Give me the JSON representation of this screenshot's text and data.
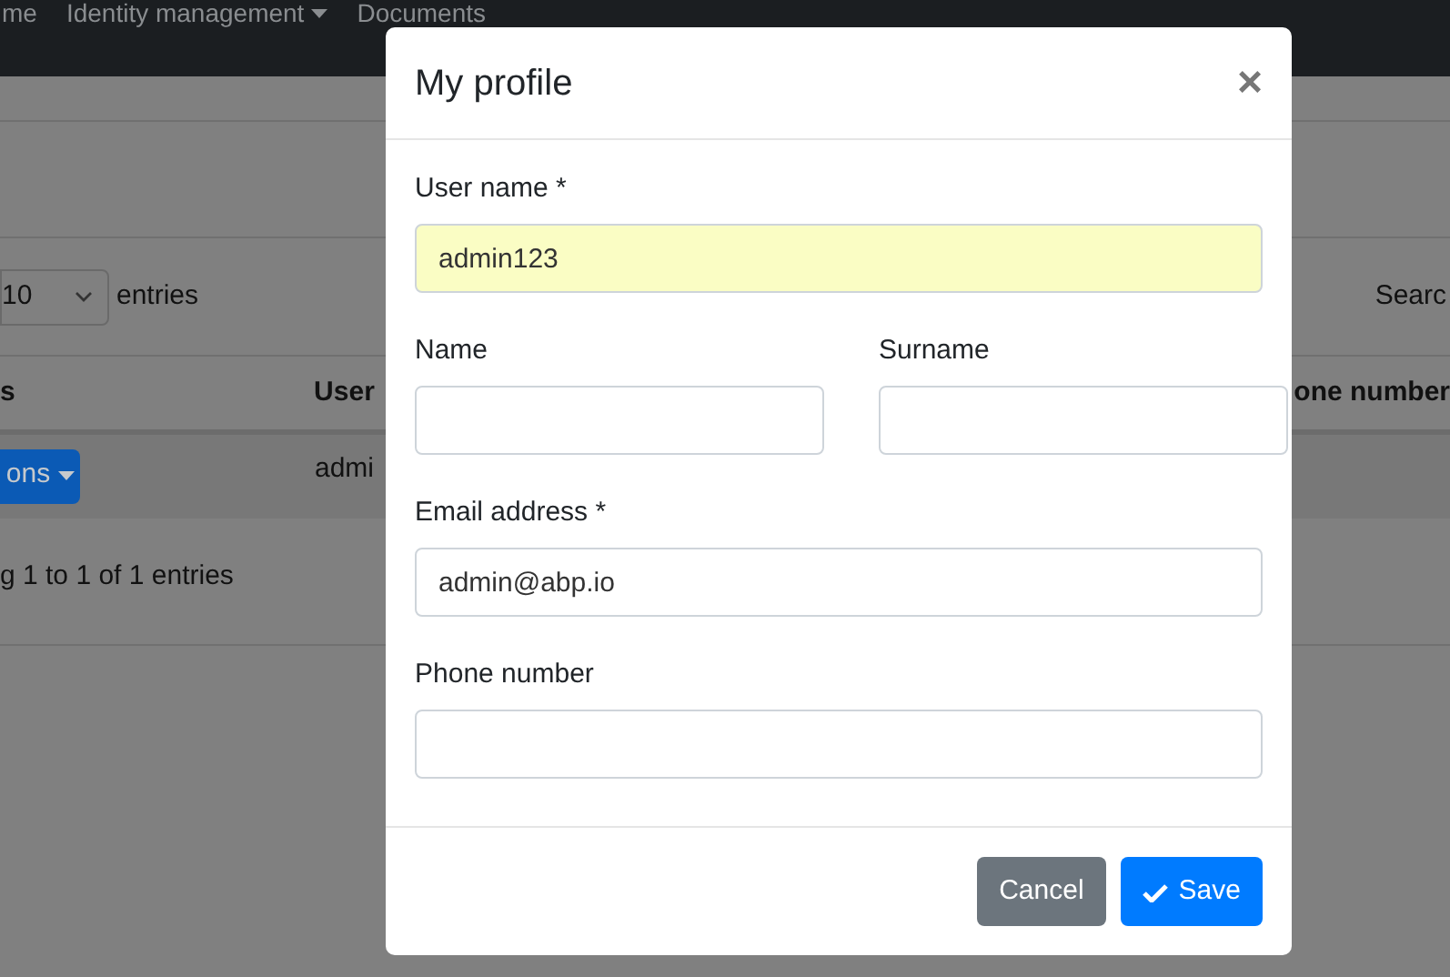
{
  "navbar": {
    "items": [
      {
        "label": "me",
        "dropdown": false
      },
      {
        "label": "Identity management",
        "dropdown": true
      },
      {
        "label": "Documents",
        "dropdown": false
      }
    ]
  },
  "background": {
    "page_size": "10",
    "entries_label": "entries",
    "search_label": "Searc",
    "columns": [
      "s",
      "User",
      "one number"
    ],
    "rows": [
      {
        "actions_button": "ons",
        "user_name": "admi"
      }
    ],
    "info": "g 1 to 1 of 1 entries"
  },
  "modal": {
    "title": "My profile",
    "close": "×",
    "field_rows": [
      [
        {
          "label": "User name *",
          "value": "admin123",
          "autofilled": true
        }
      ],
      [
        {
          "label": "Name",
          "autofilled": false
        },
        {
          "label": "Surname",
          "autofilled": false
        }
      ],
      [
        {
          "label": "Email address *",
          "value": "admin@abp.io",
          "autofilled": false
        }
      ],
      [
        {
          "label": "Phone number",
          "autofilled": false
        }
      ]
    ],
    "buttons": [
      {
        "label": "Cancel",
        "kind": "secondary"
      },
      {
        "label": "Save",
        "kind": "primary"
      }
    ]
  }
}
